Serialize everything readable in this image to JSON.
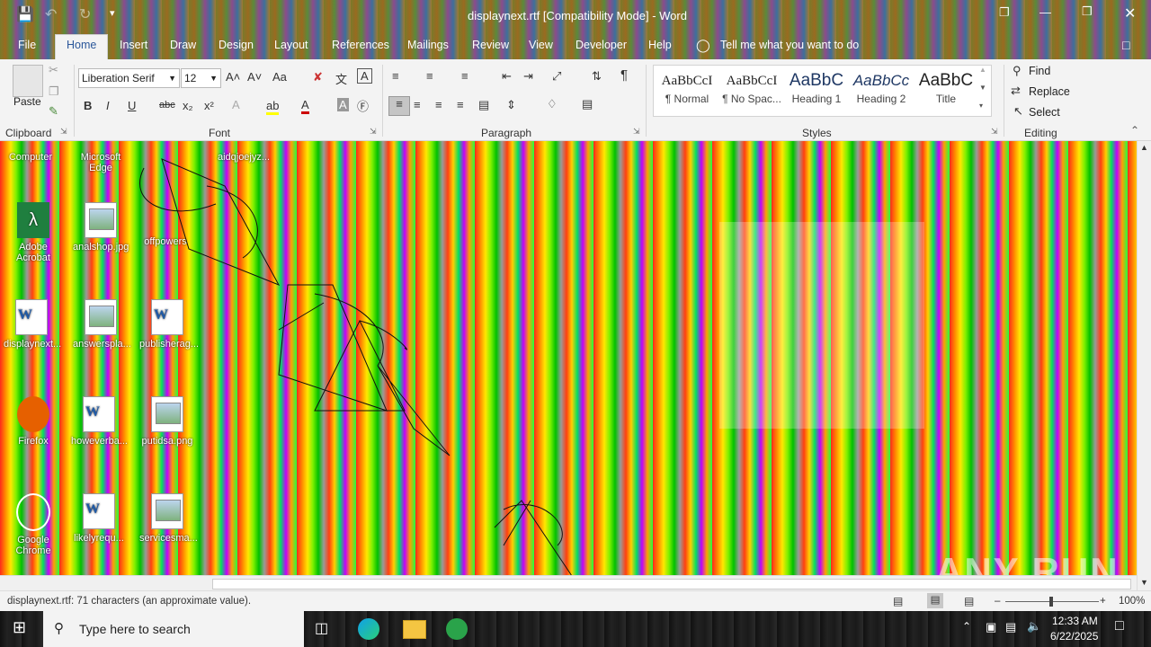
{
  "window": {
    "title": "displaynext.rtf [Compatibility Mode]  -  Word",
    "controls": [
      "❐",
      "—",
      "❒",
      "✕"
    ]
  },
  "qat": {
    "save": "💾",
    "undo": "↶",
    "redo": "↻",
    "customize": "▾"
  },
  "tabs": [
    "File",
    "Home",
    "Insert",
    "Draw",
    "Design",
    "Layout",
    "References",
    "Mailings",
    "Review",
    "View",
    "Developer",
    "Help"
  ],
  "tell_me": "Tell me what you want to do",
  "clipboard": {
    "paste": "Paste",
    "label": "Clipboard"
  },
  "font": {
    "name": "Liberation Serif",
    "size": "12",
    "label": "Font",
    "bold": "B",
    "italic": "I",
    "underline": "U",
    "strike": "abc",
    "sub": "x₂",
    "sup": "x²",
    "grow": "A˄",
    "shrink": "A˅",
    "case": "Aa",
    "clear": "✘",
    "highlight": "ab",
    "color": "A"
  },
  "paragraph": {
    "label": "Paragraph",
    "pilcrow": "¶"
  },
  "styles": {
    "label": "Styles",
    "items": [
      {
        "sample": "AaBbCcI",
        "name": "¶ Normal"
      },
      {
        "sample": "AaBbCcI",
        "name": "¶ No Spac..."
      },
      {
        "sample": "AaBbC",
        "name": "Heading 1"
      },
      {
        "sample": "AaBbCc",
        "name": "Heading 2"
      },
      {
        "sample": "AaBbC",
        "name": "Title"
      }
    ]
  },
  "editing": {
    "label": "Editing",
    "find": "Find",
    "replace": "Replace",
    "select": "Select"
  },
  "desktop_icons": [
    {
      "label": "Adobe Acrobat"
    },
    {
      "label": "analshop.jpg"
    },
    {
      "label": "offpowers"
    },
    {
      "label": "displaynext..."
    },
    {
      "label": "answerspla..."
    },
    {
      "label": "publisherag..."
    },
    {
      "label": "Firefox"
    },
    {
      "label": "howeverba..."
    },
    {
      "label": "putidsa.png"
    },
    {
      "label": "Google Chrome"
    },
    {
      "label": "likelyrequ..."
    },
    {
      "label": "servicesma..."
    }
  ],
  "top_partial_labels": [
    "Computer",
    "Microsoft Edge",
    "aidqjoejyz..."
  ],
  "status": {
    "text": "displaynext.rtf: 71 characters (an approximate value).",
    "zoom": "100%"
  },
  "taskbar": {
    "search_placeholder": "Type here to search",
    "time": "12:33 AM",
    "date": "6/22/2025"
  },
  "watermark": "ANY RUN"
}
